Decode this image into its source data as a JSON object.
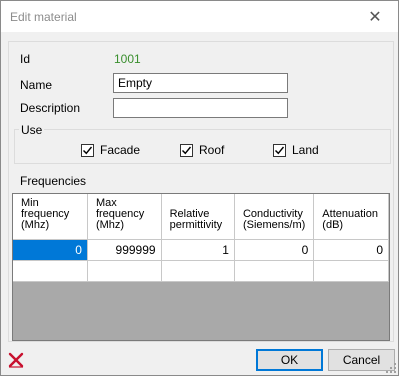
{
  "window": {
    "title": "Edit material",
    "close_glyph": "✕"
  },
  "fields": {
    "id_label": "Id",
    "id_value": "1001",
    "name_label": "Name",
    "name_value": "Empty",
    "description_label": "Description",
    "description_value": ""
  },
  "use": {
    "title": "Use",
    "options": [
      {
        "label": "Facade",
        "checked": true
      },
      {
        "label": "Roof",
        "checked": true
      },
      {
        "label": "Land",
        "checked": true
      }
    ]
  },
  "frequencies": {
    "title": "Frequencies",
    "columns": [
      {
        "line1": "Min",
        "line2": "frequency",
        "line3": "(Mhz)"
      },
      {
        "line1": "Max",
        "line2": "frequency",
        "line3": "(Mhz)"
      },
      {
        "line1": "Relative",
        "line2": "permittivity",
        "line3": ""
      },
      {
        "line1": "Conductivity",
        "line2": "(Siemens/m)",
        "line3": ""
      },
      {
        "line1": "Attenuation",
        "line2": "(dB)",
        "line3": ""
      }
    ],
    "rows": [
      [
        "0",
        "999999",
        "1",
        "0",
        "0"
      ],
      [
        "",
        "",
        "",
        "",
        ""
      ]
    ]
  },
  "buttons": {
    "ok": "OK",
    "cancel": "Cancel"
  },
  "icons": {
    "delete": "red-x-delete-icon"
  },
  "colors": {
    "selection": "#0078d7",
    "id_text": "#3a8f2e",
    "delete_red": "#c8102e"
  }
}
